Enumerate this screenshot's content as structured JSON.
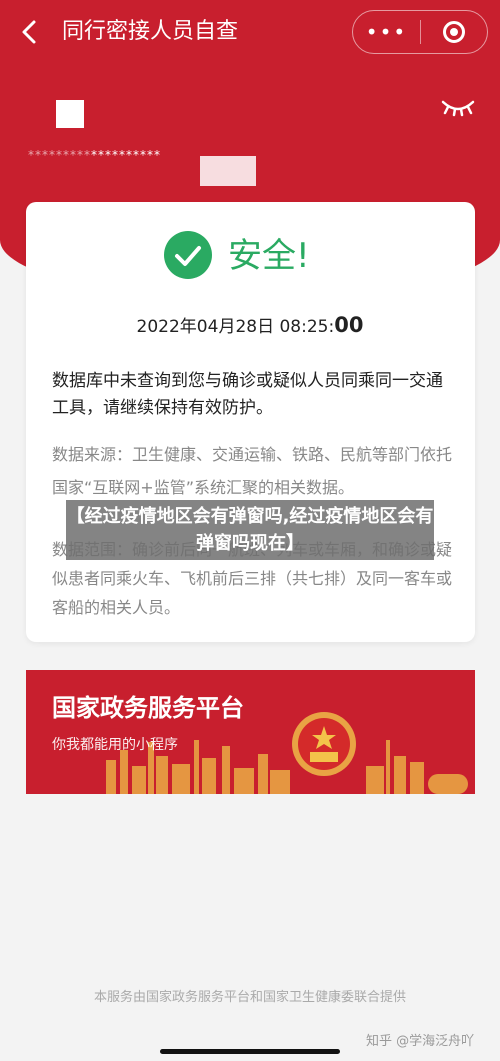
{
  "nav": {
    "title": "同行密接人员自查",
    "more_icon": "•••"
  },
  "user": {
    "masked_id_prefix": "*********",
    "masked_id_main": "**********"
  },
  "status": {
    "label": "安全!",
    "date": "2022年04月28日 08:25:",
    "seconds": "00",
    "result": "数据库中未查询到您与确诊或疑似人员同乘同一交通工具，请继续保持有效防护。",
    "source": "数据来源：卫生健康、交通运输、铁路、民航等部门依托国家“互联网+监管”系统汇聚的相关数据。",
    "scope": "数据范围：确诊前后同一航班、列车或车厢，和确诊或疑似患者同乘火车、飞机前后三排（共七排）及同一客车或客船的相关人员。"
  },
  "overlay": {
    "text": "【经过疫情地区会有弹窗吗,经过疫情地区会有弹窗吗现在】"
  },
  "banner": {
    "title": "国家政务服务平台",
    "subtitle": "你我都能用的小程序"
  },
  "footer": {
    "text": "本服务由国家政务服务平台和国家卫生健康委联合提供"
  },
  "watermark": {
    "text": "知乎 @学海泛舟吖"
  },
  "colors": {
    "brand_red": "#c81f2e",
    "safe_green": "#2aaa62"
  }
}
